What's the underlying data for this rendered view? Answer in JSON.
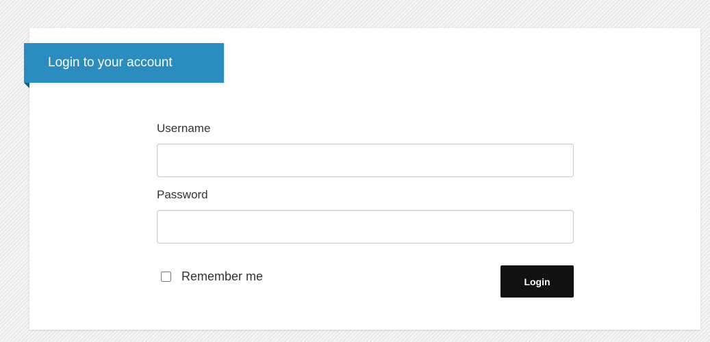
{
  "panel": {
    "title": "Login to your account"
  },
  "form": {
    "username": {
      "label": "Username",
      "value": "",
      "placeholder": ""
    },
    "password": {
      "label": "Password",
      "value": "",
      "placeholder": ""
    },
    "remember": {
      "label": "Remember me",
      "checked": false
    },
    "submit_label": "Login"
  },
  "colors": {
    "ribbon": "#2a8cbf",
    "button": "#111111",
    "card": "#ffffff"
  }
}
